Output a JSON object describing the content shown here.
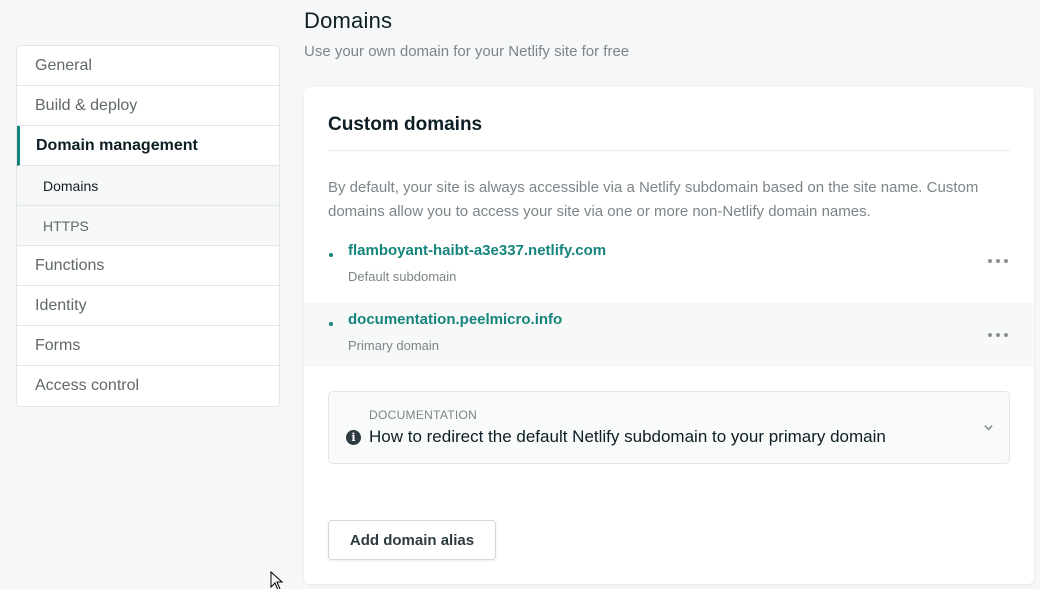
{
  "sidebar": {
    "items": [
      {
        "label": "General"
      },
      {
        "label": "Build & deploy"
      },
      {
        "label": "Domain management"
      },
      {
        "label": "Domains"
      },
      {
        "label": "HTTPS"
      },
      {
        "label": "Functions"
      },
      {
        "label": "Identity"
      },
      {
        "label": "Forms"
      },
      {
        "label": "Access control"
      }
    ]
  },
  "header": {
    "title": "Domains",
    "subtitle": "Use your own domain for your Netlify site for free"
  },
  "custom_domains": {
    "title": "Custom domains",
    "description": "By default, your site is always accessible via a Netlify subdomain based on the site name. Custom domains allow you to access your site via one or more non-Netlify domain names.",
    "domains": [
      {
        "name": "flamboyant-haibt-a3e337.netlify.com",
        "label": "Default subdomain"
      },
      {
        "name": "documentation.peelmicro.info",
        "label": "Primary domain"
      }
    ],
    "doc": {
      "kicker": "DOCUMENTATION",
      "text": "How to redirect the default Netlify subdomain to your primary domain"
    },
    "add_button": "Add domain alias"
  },
  "colors": {
    "accent": "#15847d",
    "text": "#0e1e25",
    "muted": "#7d8589",
    "background": "#f6f7f8"
  }
}
